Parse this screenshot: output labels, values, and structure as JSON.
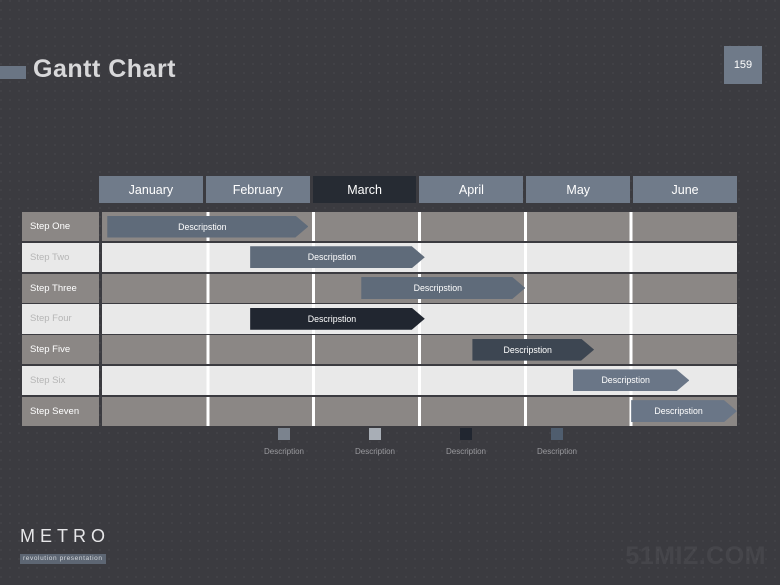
{
  "title": "Gantt Chart",
  "page_number": "159",
  "colors": {
    "background": "#3b3b40",
    "month_default": "#707b8a",
    "month_active": "#262b33",
    "row_odd": "#8b8785",
    "row_even": "#e9e9e9",
    "bar_slate": "#5f6b7a",
    "bar_dark": "#212630",
    "badge": "#6f7a89"
  },
  "chart_data": {
    "type": "bar",
    "title": "Gantt Chart",
    "xlabel": "",
    "ylabel": "",
    "categories": [
      "January",
      "February",
      "March",
      "April",
      "May",
      "June"
    ],
    "active_category": "March",
    "tasks": [
      {
        "label": "Step One",
        "bar_label": "Descripstion",
        "start": 0.05,
        "end": 1.95,
        "color": "#5f6b7a"
      },
      {
        "label": "Step Two",
        "bar_label": "Descripstion",
        "start": 1.4,
        "end": 3.05,
        "color": "#5f6b7a"
      },
      {
        "label": "Step Three",
        "bar_label": "Descripstion",
        "start": 2.45,
        "end": 4.0,
        "color": "#5f6b7a"
      },
      {
        "label": "Step Four",
        "bar_label": "Descripstion",
        "start": 1.4,
        "end": 3.05,
        "color": "#212630"
      },
      {
        "label": "Step Five",
        "bar_label": "Descripstion",
        "start": 3.5,
        "end": 4.65,
        "color": "#3d4652"
      },
      {
        "label": "Step Six",
        "bar_label": "Descripstion",
        "start": 4.45,
        "end": 5.55,
        "color": "#6a7687"
      },
      {
        "label": "Step Seven",
        "bar_label": "Descripstion",
        "start": 5.0,
        "end": 6.0,
        "color": "#6a7687"
      }
    ]
  },
  "legend": [
    {
      "label": "Description",
      "color": "#7b838e"
    },
    {
      "label": "Description",
      "color": "#a8aeb6"
    },
    {
      "label": "Description",
      "color": "#212630"
    },
    {
      "label": "Description",
      "color": "#4f5d6e"
    }
  ],
  "footer": {
    "logo_name": "METRO",
    "logo_tagline": "revolution presentation",
    "watermark": "51MIZ.COM"
  }
}
